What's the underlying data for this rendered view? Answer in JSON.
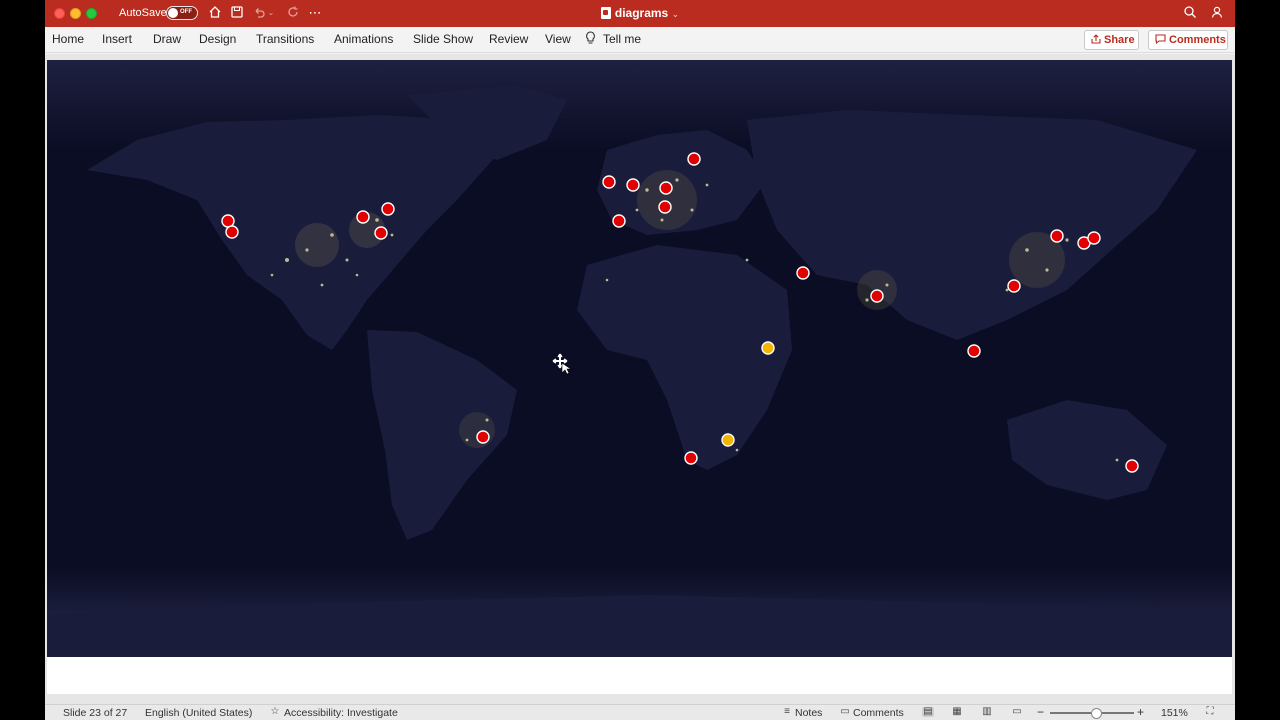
{
  "titlebar": {
    "autosave_label": "AutoSave",
    "autosave_state": "OFF",
    "doc_title": "diagrams"
  },
  "ribbon": {
    "tabs": [
      "Home",
      "Insert",
      "Draw",
      "Design",
      "Transitions",
      "Animations",
      "Slide Show",
      "Review",
      "View",
      "Tell me"
    ],
    "share_label": "Share",
    "comments_label": "Comments"
  },
  "map": {
    "marker_colors": {
      "red": "#e00000",
      "yellow": "#f2b600"
    },
    "markers": [
      {
        "city": "",
        "color": "red"
      }
    ]
  },
  "status": {
    "slide": "Slide 23 of 27",
    "language": "English (United States)",
    "accessibility": "Accessibility: Investigate",
    "notes": "Notes",
    "comments": "Comments",
    "zoom": "151%"
  },
  "colors": {
    "accent": "#b92c1f",
    "slide_bg": "#0a0c22"
  }
}
